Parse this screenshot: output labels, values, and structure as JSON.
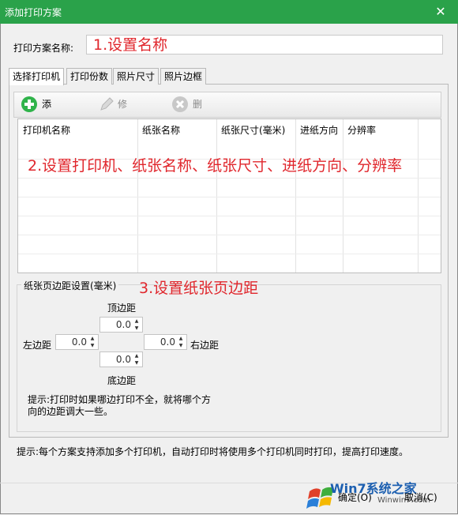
{
  "window": {
    "title": "添加打印方案",
    "close_glyph": "✕"
  },
  "scheme_name": {
    "label": "打印方案名称:",
    "value": ""
  },
  "annotations": {
    "a1": "1.设置名称",
    "a2": "2.设置打印机、纸张名称、纸张尺寸、进纸方向、分辨率",
    "a3": "3.设置纸张页边距"
  },
  "tabs": [
    {
      "label": "选择打印机"
    },
    {
      "label": "打印份数"
    },
    {
      "label": "照片尺寸"
    },
    {
      "label": "照片边框"
    }
  ],
  "toolbar": {
    "add": "添加打印机",
    "edit": "修改打印机",
    "delete": "删除打印机"
  },
  "grid": {
    "columns": [
      "打印机名称",
      "纸张名称",
      "纸张尺寸(毫米)",
      "进纸方向",
      "分辨率"
    ]
  },
  "margins": {
    "group_label": "纸张页边距设置(毫米)",
    "top_label": "顶边距",
    "left_label": "左边距",
    "right_label": "右边距",
    "bottom_label": "底边距",
    "top": "0.0",
    "left": "0.0",
    "right": "0.0",
    "bottom": "0.0",
    "hint1": "提示:打印时如果哪边打印不全，就将哪个方",
    "hint2": "向的边距调大一些。"
  },
  "footer_hint": "提示:每个方案支持添加多个打印机，自动打印时将使用多个打印机同时打印，提高打印速度。",
  "buttons": {
    "ok": "确定(O)",
    "cancel": "取消(C)"
  },
  "watermark": {
    "text": "Win7系统之家",
    "url": "Winwin7.com"
  },
  "colors": {
    "titlebar": "#2aa24a",
    "annotation": "#e0262c",
    "add_icon": "#2fb34a"
  }
}
